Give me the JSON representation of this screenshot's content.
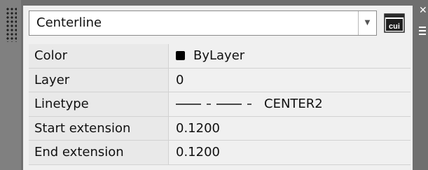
{
  "dropdown": {
    "value": "Centerline"
  },
  "cui_button": {
    "label": "cui",
    "icon": "cui-icon"
  },
  "properties": [
    {
      "name": "Color",
      "value": "ByLayer",
      "swatch_color": "#000000"
    },
    {
      "name": "Layer",
      "value": "0"
    },
    {
      "name": "Linetype",
      "value": "CENTER2"
    },
    {
      "name": "Start extension",
      "value": "0.1200"
    },
    {
      "name": "End extension",
      "value": "0.1200"
    }
  ]
}
